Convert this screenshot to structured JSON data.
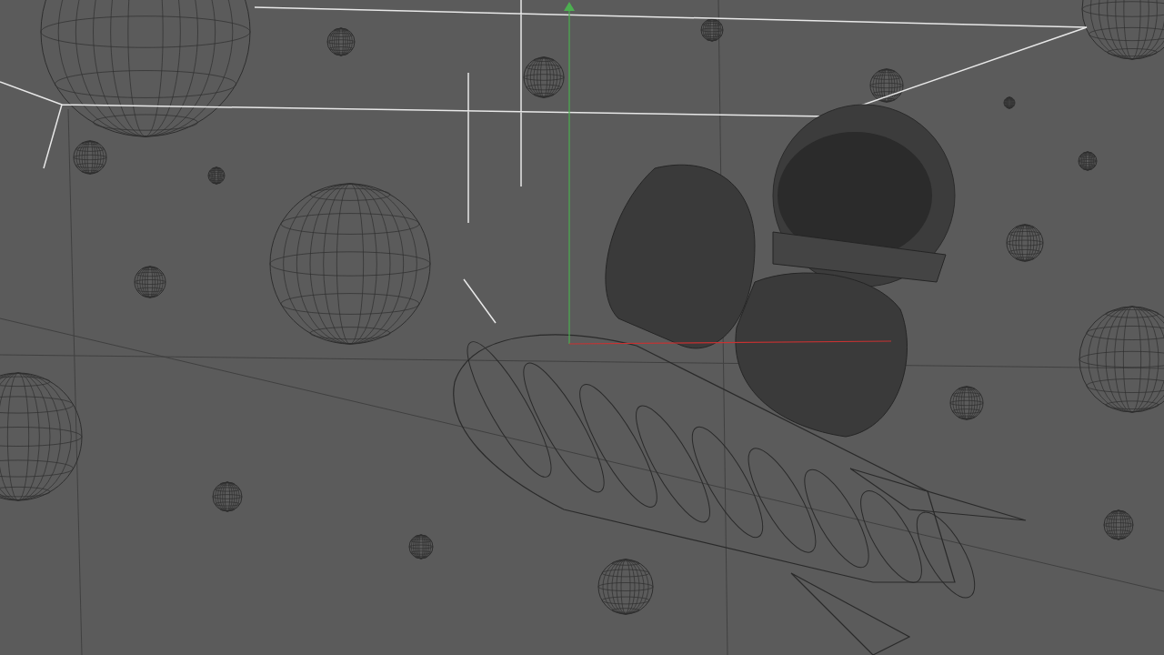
{
  "viewport": {
    "axes_visible": true
  }
}
